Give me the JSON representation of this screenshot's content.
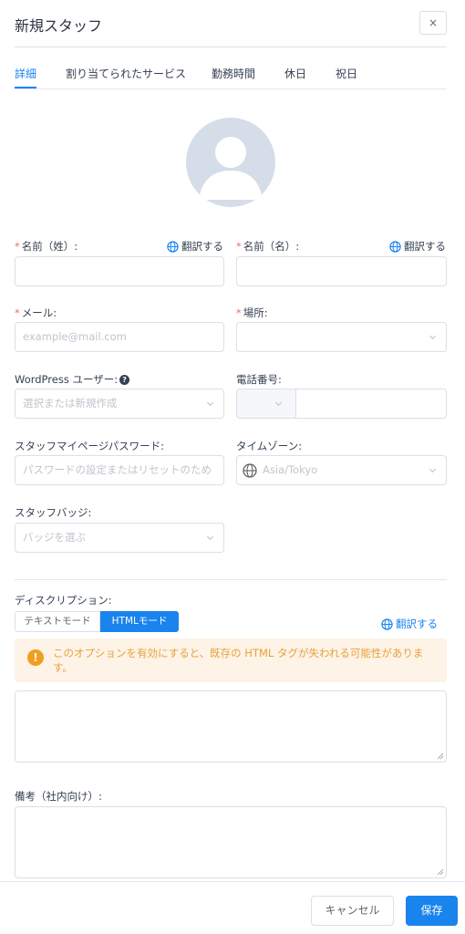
{
  "header": {
    "title": "新規スタッフ",
    "close_label": "×"
  },
  "tabs": [
    {
      "label": "詳細",
      "active": true
    },
    {
      "label": "割り当てられたサービス",
      "active": false
    },
    {
      "label": "勤務時間",
      "active": false
    },
    {
      "label": "休日",
      "active": false
    },
    {
      "label": "祝日",
      "active": false
    }
  ],
  "form": {
    "required_mark": "*",
    "translate_label": "翻訳する",
    "first_name": {
      "label": "名前（姓）:",
      "value": ""
    },
    "last_name": {
      "label": "名前（名）:",
      "value": ""
    },
    "email": {
      "label": "メール:",
      "placeholder": "example@mail.com"
    },
    "location": {
      "label": "場所:",
      "value": ""
    },
    "wp_user": {
      "label": "WordPress ユーザー:",
      "help_icon": "?",
      "placeholder": "選択または新規作成"
    },
    "phone": {
      "label": "電話番号:",
      "value": ""
    },
    "password": {
      "label": "スタッフマイページパスワード:",
      "placeholder": "パスワードの設定またはリセットのため"
    },
    "timezone": {
      "label": "タイムゾーン:",
      "placeholder": "Asia/Tokyo"
    },
    "badge": {
      "label": "スタッフバッジ:",
      "placeholder": "バッジを選ぶ"
    },
    "description": {
      "label": "ディスクリプション:",
      "mode_text": "テキストモード",
      "mode_html": "HTMLモード",
      "active_mode": "html",
      "alert": "このオプションを有効にすると、既存の HTML タグが失われる可能性があります。",
      "value": ""
    },
    "internal_note": {
      "label": "備考（社内向け）:",
      "value": ""
    }
  },
  "footer": {
    "cancel_label": "キャンセル",
    "save_label": "保存"
  },
  "colors": {
    "accent": "#1a84ee",
    "required": "#f56c6c",
    "warning": "#e6a23c",
    "warning_bg": "#fdf3e7"
  }
}
